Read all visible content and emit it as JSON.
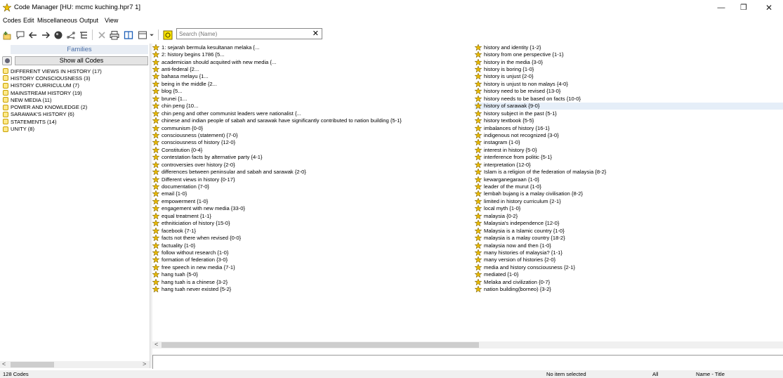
{
  "window": {
    "title": "Code Manager [HU: mcmc kuching.hpr7 1]",
    "minimize": "—",
    "maximize": "❐",
    "close": "✕"
  },
  "menu": [
    "Codes",
    "Edit",
    "Miscellaneous",
    "Output",
    "View"
  ],
  "toolbar": {
    "icons": [
      "new-code-icon",
      "comment-icon",
      "back-icon",
      "forward-icon",
      "globe-icon",
      "network-icon",
      "tree-icon",
      "delete-icon",
      "print-icon",
      "single-pane-icon",
      "split-view-icon",
      "filter-icon"
    ],
    "search_placeholder": "Search (Name)",
    "clear": "✕"
  },
  "families": {
    "header": "Families",
    "show_all": "Show all Codes",
    "items": [
      "DIFFERENT VIEWS IN HISTORY (17)",
      "HISTORY CONSCIOUSNESS (3)",
      "HISTORY CURRICULUM (7)",
      "MAINSTREAM HISTORY (19)",
      "NEW MEDIA (11)",
      "POWER AND KNOWLEDGE (2)",
      "SARAWAK'S HISTORY (6)",
      "STATEMENTS (14)",
      "UNITY (8)"
    ]
  },
  "codes": {
    "column1": [
      "1: sejarah bermula kesultanan melaka {...",
      "2: history begins 1786 {5...",
      "academician should acquited with new media {...",
      "anti-federal {2...",
      "bahasa melayu {1...",
      "being in the middle {2...",
      "blog {5...",
      "brunei {1...",
      "chin peng {10...",
      "chin peng and other communist leaders were nationalist {...",
      "chinese and indian people of sabah and sarawak have significantly contributed to nation building {5-1}",
      "communism {0-0}",
      "consciousness (statement) {7-0}",
      "consciousness of history {12-0}",
      "Constitution {0-4}",
      "contestation facts by alternative party {4-1}",
      "controversies over history {2-0}",
      "differences between peninsular and sabah and sarawak {2-0}",
      "Different views in history {0-17}",
      "documentation {7-0}",
      "email {1-0}",
      "empowerment {1-0}",
      "engagement with new media {33-0}",
      "equal treatment {1-1}",
      "ethniticiation of history {15-0}",
      "facebook {7-1}",
      "facts not there when revised {0-0}",
      "factuality {1-0}",
      "follow without research {1-0}",
      "formation of federation {3-0}",
      "free speech in new media {7-1}",
      "hang tuah {5-0}",
      "hang tuah is a chinese {3-2}",
      "hang tuah never existed {5-2}"
    ],
    "column2": [
      "history and identity {1-2}",
      "history from one perspective {1-1}",
      "history in the media {3-0}",
      "history is boring {1-0}",
      "history is unjust {2-0}",
      "history is unjust to non malays {4-0}",
      "history need to be revised {13-0}",
      "history needs to be based on facts {10-0}",
      "history of sarawak {9-0}",
      "history subject in the past {5-1}",
      "history textbook {5-5}",
      "imbalances of history {16-1}",
      "indigenous not recognized {3-0}",
      "instagram {1-0}",
      "interest in history {5-0}",
      "interference from politic {5-1}",
      "interpretation {12-0}",
      "Islam is a religion of the federation of malaysia {8-2}",
      "kewarganegaraan {1-0}",
      "leader of the murut {1-0}",
      "lembah bujang is a malay civilisation {8-2}",
      "limited in history curriculum {2-1}",
      "local myth {1-0}",
      "malaysia {0-2}",
      "Malaysia's independence {12-0}",
      "Malaysia is a Islamic country {1-0}",
      "malaysia is a malay country {18-2}",
      "malaysia now and then {1-0}",
      "many histories of malaysia? {1-1}",
      "many version of histories {2-0}",
      "media and history consciousness {2-1}",
      "mediated {1-0}",
      "Melaka and civilization {0-7}",
      "nation building(borneo) {3-2}"
    ],
    "selected": "history of sarawak {9-0}"
  },
  "status": {
    "count": "128 Codes",
    "selection": "No item selected",
    "filter": "All",
    "sort": "Name - Title"
  },
  "colors": {
    "accent": "#4a6fa8",
    "selection": "#e5eef8",
    "code_icon": "#e8b800"
  }
}
